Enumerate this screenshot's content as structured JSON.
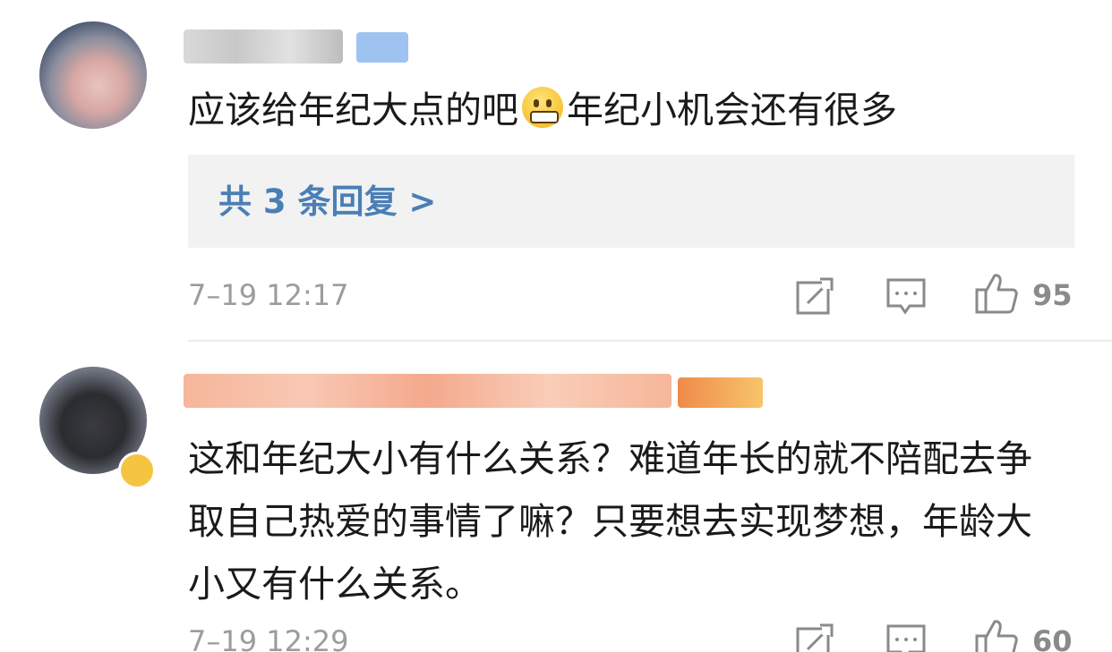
{
  "comments": [
    {
      "text_before": "应该给年纪大点的吧",
      "text_after": "年纪小机会还有很多",
      "replies_label": "共 3 条回复 >",
      "time": "7–19 12:17",
      "likes": "95"
    },
    {
      "text": "这和年纪大小有什么关系？难道年长的就不陪配去争取自己热爱的事情了嘛？只要想去实现梦想，年龄大小又有什么关系。",
      "time": "7–19 12:29",
      "likes": "60"
    }
  ],
  "icons": [
    "avatar",
    "share-icon",
    "comment-icon",
    "like-icon",
    "grimacing-emoji"
  ],
  "colors": {
    "link": "#4a7fb5",
    "meta": "#9c9c9c",
    "replies_bg": "#f2f2f2"
  }
}
